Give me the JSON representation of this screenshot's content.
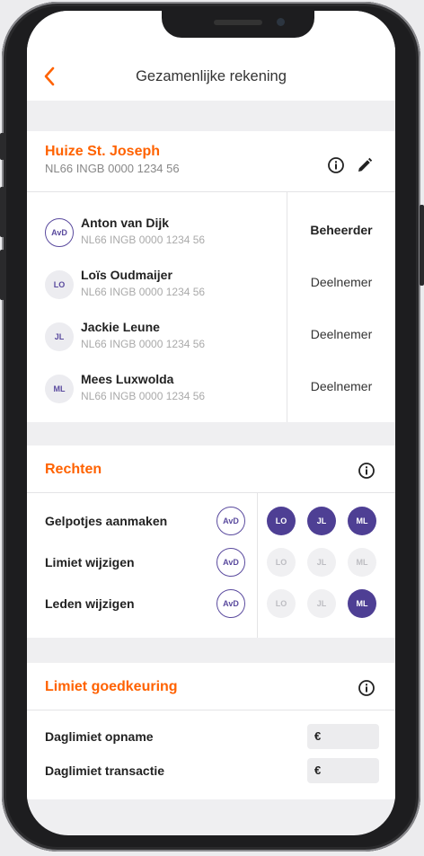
{
  "header": {
    "title": "Gezamenlijke rekening",
    "back_icon": "chevron-left-icon"
  },
  "account": {
    "name": "Huize St. Joseph",
    "iban": "NL66 INGB 0000 1234 56"
  },
  "members": [
    {
      "initials": "AvD",
      "name": "Anton van Dijk",
      "iban": "NL66 INGB 0000 1234 56",
      "role": "Beheerder"
    },
    {
      "initials": "LO",
      "name": "Loïs Oudmaijer",
      "iban": "NL66 INGB 0000 1234 56",
      "role": "Deelnemer"
    },
    {
      "initials": "JL",
      "name": "Jackie Leune",
      "iban": "NL66 INGB 0000 1234 56",
      "role": "Deelnemer"
    },
    {
      "initials": "ML",
      "name": "Mees Luxwolda",
      "iban": "NL66 INGB 0000 1234 56",
      "role": "Deelnemer"
    }
  ],
  "rights": {
    "title": "Rechten",
    "rows": [
      {
        "label": "Gelpotjes aanmaken",
        "owner": "AvD",
        "lo": "LO",
        "jl": "JL",
        "ml": "ML"
      },
      {
        "label": "Limiet wijzigen",
        "owner": "AvD",
        "lo": "LO",
        "jl": "JL",
        "ml": "ML"
      },
      {
        "label": "Leden wijzigen",
        "owner": "AvD",
        "lo": "LO",
        "jl": "JL",
        "ml": "ML"
      }
    ]
  },
  "limits": {
    "title": "Limiet goedkeuring",
    "rows": [
      {
        "label": "Daglimiet opname",
        "currency": "€"
      },
      {
        "label": "Daglimiet transactie",
        "currency": "€"
      }
    ]
  },
  "colors": {
    "accent": "#ff6200",
    "purple": "#4e3f94"
  }
}
